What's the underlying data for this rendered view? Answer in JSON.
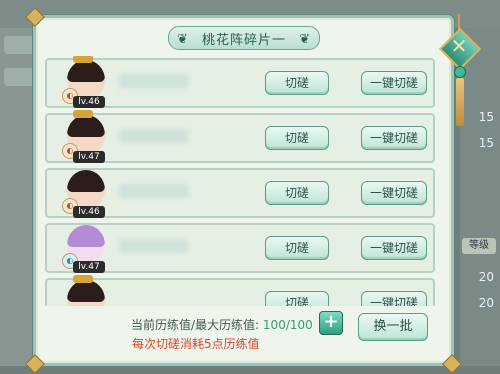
{
  "dialog": {
    "title": "桃花阵碎片一",
    "rows": [
      {
        "level": "lv.46",
        "btn_cut": "切磋",
        "btn_onekey": "一键切磋"
      },
      {
        "level": "lv.47",
        "btn_cut": "切磋",
        "btn_onekey": "一键切磋"
      },
      {
        "level": "lv.46",
        "btn_cut": "切磋",
        "btn_onekey": "一键切磋"
      },
      {
        "level": "lv.47",
        "btn_cut": "切磋",
        "btn_onekey": "一键切磋"
      },
      {
        "level": "",
        "btn_cut": "切磋",
        "btn_onekey": "一键切磋"
      }
    ],
    "footer": {
      "label": "当前历练值/最大历练值:",
      "value": "100/100",
      "cost_note": "每次切磋消耗5点历练值",
      "plus": "+",
      "refresh": "换一批"
    }
  },
  "background": {
    "numbers": [
      "15",
      "15",
      "20",
      "20"
    ],
    "tag": "等级"
  },
  "close": {
    "icon": "close-icon"
  },
  "colors": {
    "accent": "#5f9c89",
    "warning": "#d44a2e",
    "value": "#3a9b66"
  }
}
